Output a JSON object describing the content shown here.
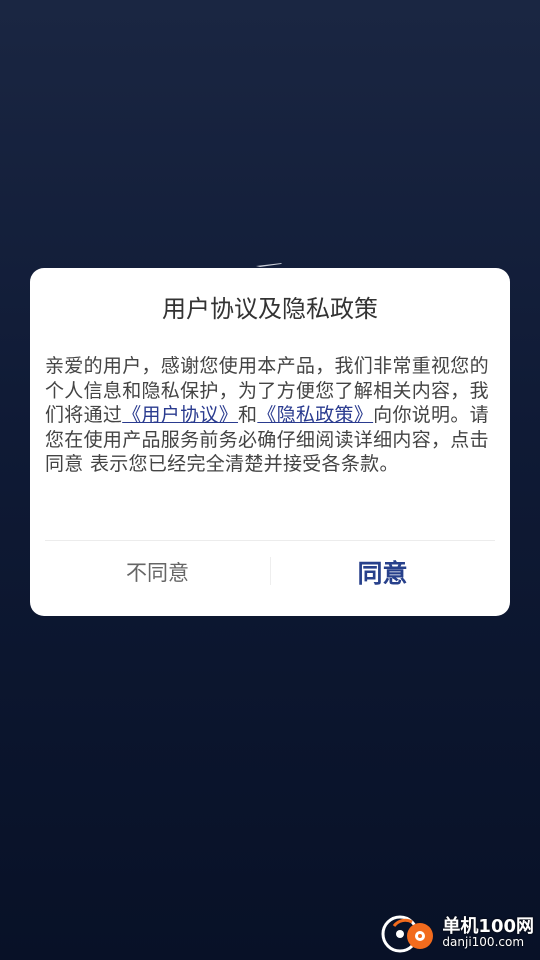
{
  "dialog": {
    "title": "用户协议及隐私政策",
    "body_part1": "亲爱的用户，感谢您使用本产品，我们非常重视您的个人信息和隐私保护，为了方便您了解相关内容，我们将通过",
    "user_agreement_link": "《用户协议》",
    "and": "和",
    "privacy_policy_link": "《隐私政策》",
    "body_part2": "向你说明。请您在使用产品服务前务必确仔细阅读详细内容，点击 同意 表示您已经完全清楚并接受各条款。",
    "disagree_label": "不同意",
    "agree_label": "同意"
  },
  "watermark": {
    "name": "单机100网",
    "url": "danji100.com"
  },
  "colors": {
    "accent": "#27408b",
    "link": "#2a3b8f",
    "background_top": "#1a2642",
    "background_bottom": "#081127",
    "watermark_orange": "#f26b1d"
  }
}
